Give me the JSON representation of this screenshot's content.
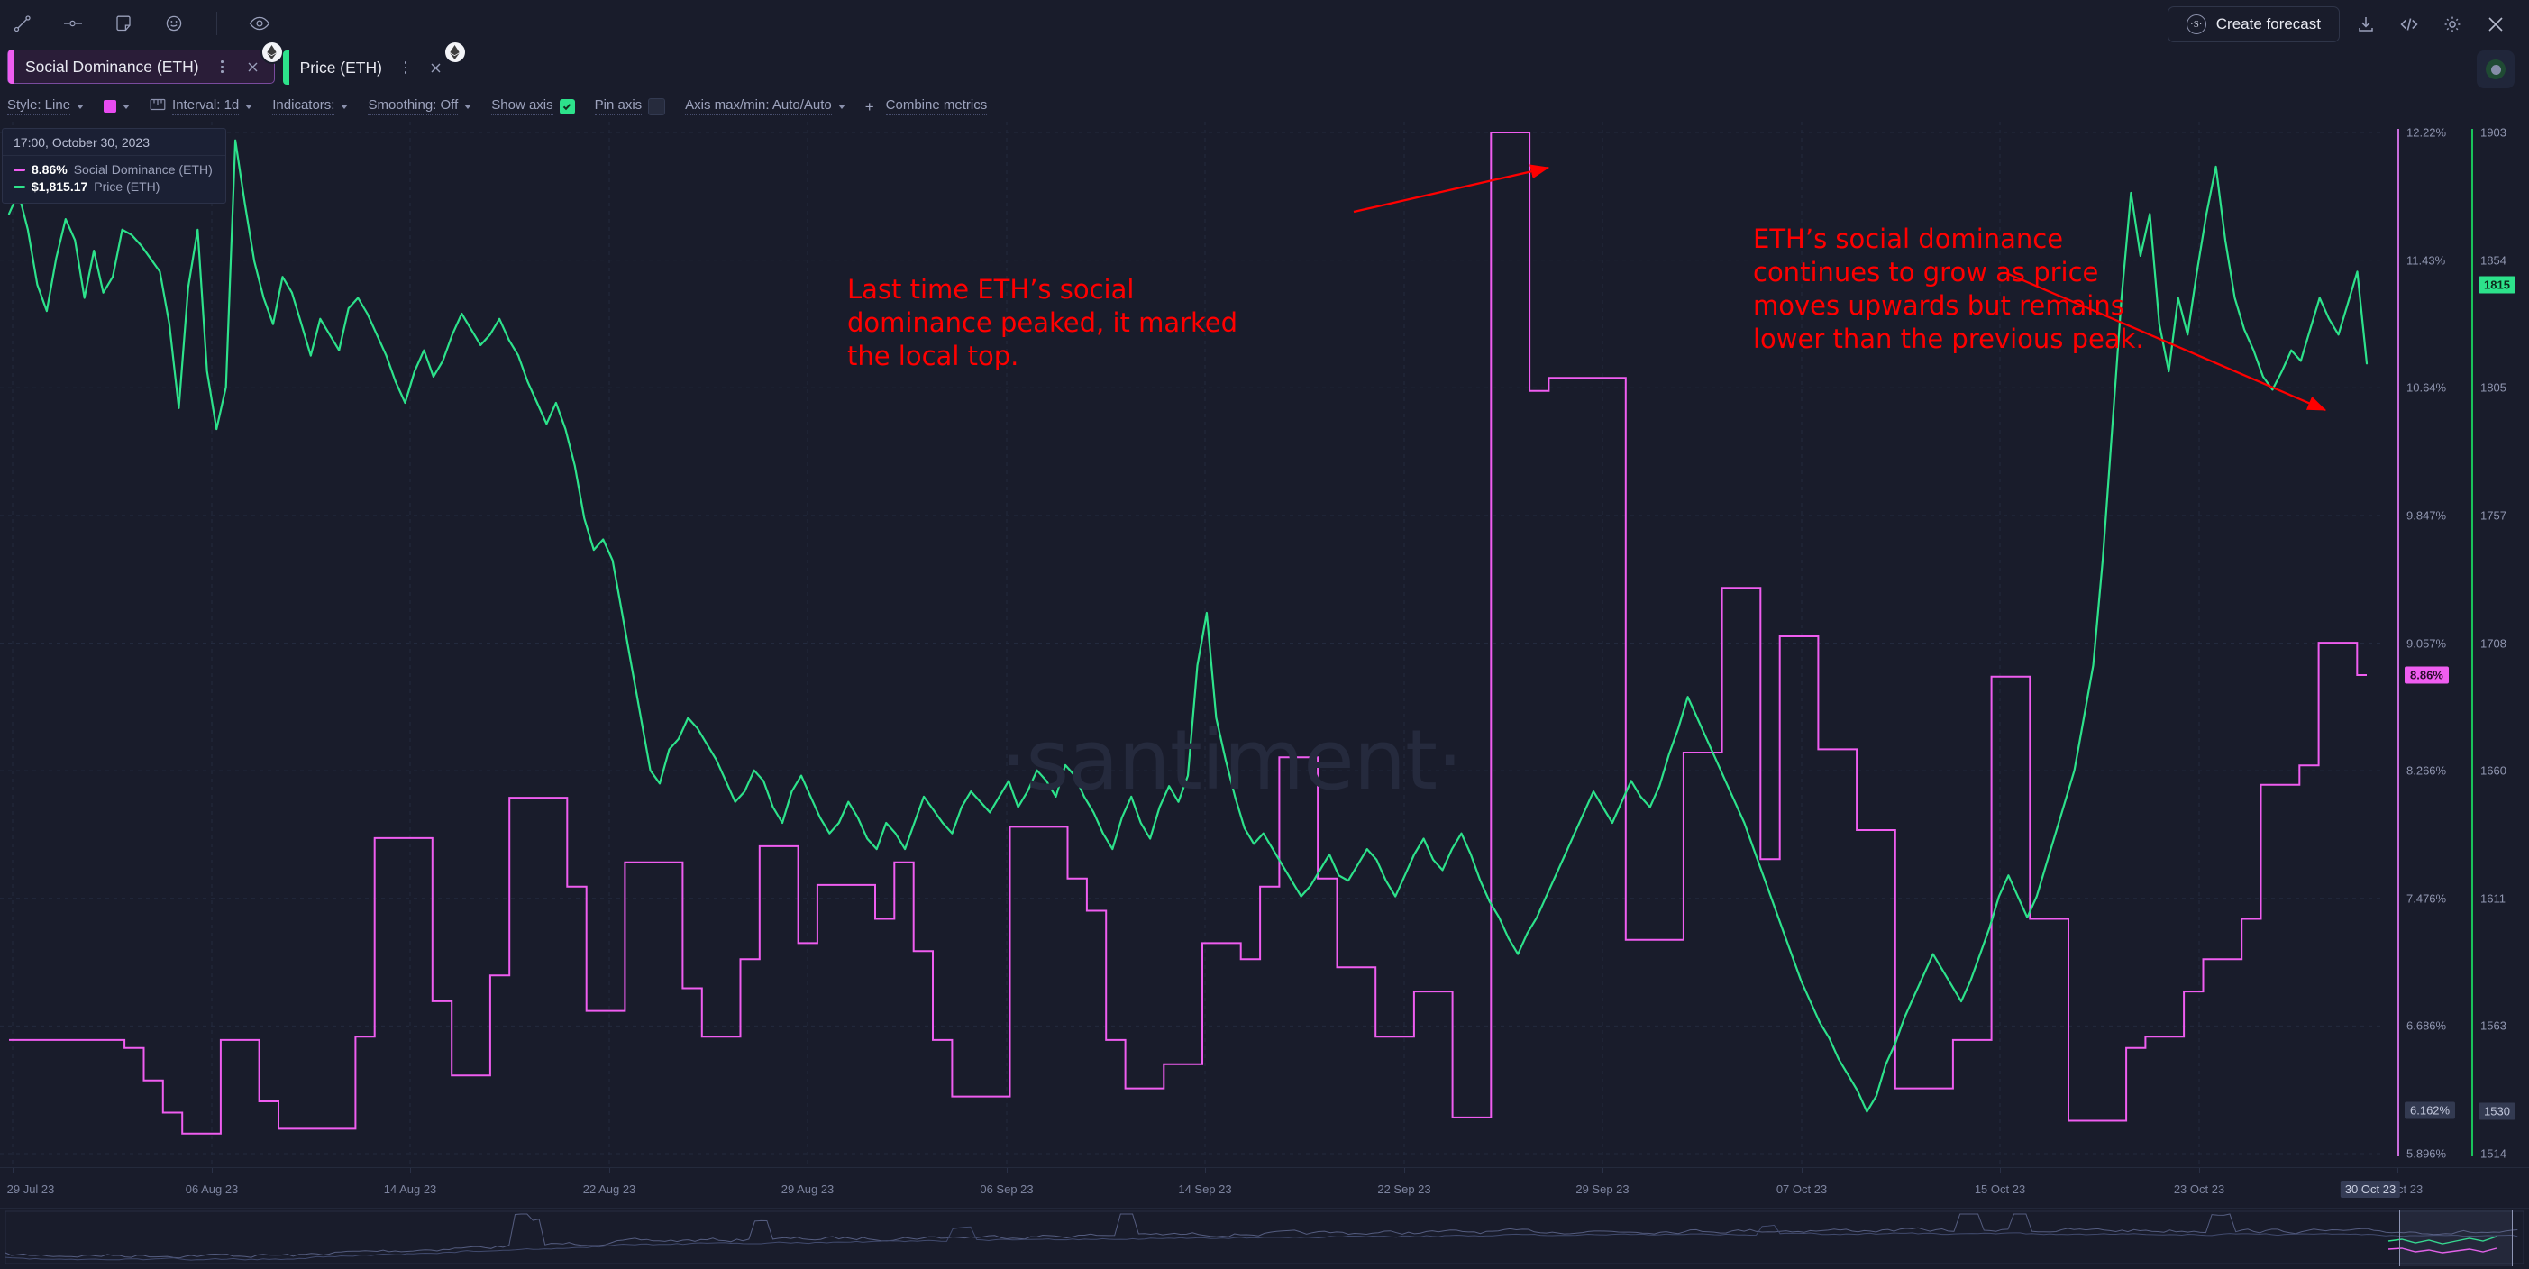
{
  "app": {
    "background": "#191c2b",
    "watermark": "·santiment·"
  },
  "toolbar": {
    "icons": [
      {
        "name": "trend-line-icon",
        "title": "Trend line"
      },
      {
        "name": "horizontal-line-icon",
        "title": "Horizontal line"
      },
      {
        "name": "note-icon",
        "title": "Note"
      },
      {
        "name": "emoji-icon",
        "title": "Emoji"
      },
      {
        "name": "visibility-icon",
        "title": "Show / hide"
      }
    ],
    "create_forecast_label": "Create forecast",
    "forecast_sigil": "·S·",
    "right_icons": [
      {
        "name": "download-icon"
      },
      {
        "name": "embed-code-icon"
      },
      {
        "name": "settings-gear-icon"
      },
      {
        "name": "close-icon"
      }
    ]
  },
  "metric_tabs": [
    {
      "label": "Social Dominance (ETH)",
      "color": "#ef5df0",
      "selected": true,
      "asset_badge": "ETH"
    },
    {
      "label": "Price (ETH)",
      "color": "#2de28b",
      "selected": false,
      "asset_badge": "ETH"
    }
  ],
  "settings_bar": {
    "style": "Style: Line",
    "color_swatch": "#e84bf0",
    "interval": "Interval: 1d",
    "indicators": "Indicators:",
    "smoothing": "Smoothing: Off",
    "show_axis": "Show axis",
    "show_axis_checked": true,
    "pin_axis": "Pin axis",
    "pin_axis_checked": false,
    "axis_max_min": "Axis max/min: Auto/Auto",
    "combine_metrics": "Combine metrics",
    "combine_plus": "+"
  },
  "legend": {
    "date": "17:00, October 30, 2023",
    "rows": [
      {
        "value": "8.86%",
        "name": "Social Dominance (ETH)",
        "color": "#ef5df0"
      },
      {
        "value": "$1,815.17",
        "name": "Price (ETH)",
        "color": "#2de28b"
      }
    ]
  },
  "annotations": [
    {
      "text": "Last time ETH’s social\ndominance peaked, it marked\nthe local top.",
      "color": "#ff0000"
    },
    {
      "text": "ETH’s social dominance\ncontinues to grow as price\nmoves upwards but remains\nlower than the previous peak.",
      "color": "#ff0000"
    }
  ],
  "axis_right": {
    "percent_ticks": [
      "12.22%",
      "11.43%",
      "10.64%",
      "9.847%",
      "9.057%",
      "8.266%",
      "7.476%",
      "6.686%",
      "5.896%"
    ],
    "price_ticks": [
      "1903",
      "1854",
      "1805",
      "1757",
      "1708",
      "1660",
      "1611",
      "1563",
      "1514"
    ],
    "current_price_badge": "1815",
    "current_percent_badge": "8.86%",
    "crosshair_percent_badge": "6.162%",
    "crosshair_price_badge": "1530",
    "percent_axis_color": "#c86ddc",
    "price_axis_color": "#19c25a"
  },
  "x_axis": {
    "ticks": [
      "29 Jul 23",
      "06 Aug 23",
      "14 Aug 23",
      "22 Aug 23",
      "29 Aug 23",
      "06 Sep 23",
      "14 Sep 23",
      "22 Sep 23",
      "29 Sep 23",
      "07 Oct 23",
      "15 Oct 23",
      "23 Oct 23",
      "31 Oct 23"
    ],
    "highlighted_tick": "30 Oct 23"
  },
  "chart_data": {
    "type": "line",
    "title": "Social Dominance (ETH) vs Price (ETH)",
    "xlabel": "",
    "ylabel": "",
    "grid": true,
    "legend_position": "top-left",
    "x_range": [
      "29 Jul 23",
      "31 Oct 23"
    ],
    "series": [
      {
        "name": "Social Dominance (ETH)",
        "color": "#ef5df0",
        "axis": "left-percent",
        "unit": "%",
        "ylim": [
          5.896,
          12.22
        ],
        "step": true,
        "values": [
          6.6,
          6.6,
          6.6,
          6.6,
          6.6,
          6.6,
          6.6,
          6.6,
          6.6,
          6.6,
          6.6,
          6.6,
          6.55,
          6.55,
          6.35,
          6.35,
          6.15,
          6.15,
          6.02,
          6.02,
          6.02,
          6.02,
          6.6,
          6.6,
          6.6,
          6.6,
          6.22,
          6.22,
          6.05,
          6.05,
          6.05,
          6.05,
          6.05,
          6.05,
          6.05,
          6.05,
          6.62,
          6.62,
          7.85,
          7.85,
          7.85,
          7.85,
          7.85,
          7.85,
          6.84,
          6.84,
          6.38,
          6.38,
          6.38,
          6.38,
          7.0,
          7.0,
          8.1,
          8.1,
          8.1,
          8.1,
          8.1,
          8.1,
          7.55,
          7.55,
          6.78,
          6.78,
          6.78,
          6.78,
          7.7,
          7.7,
          7.7,
          7.7,
          7.7,
          7.7,
          6.92,
          6.92,
          6.62,
          6.62,
          6.62,
          6.62,
          7.1,
          7.1,
          7.8,
          7.8,
          7.8,
          7.8,
          7.2,
          7.2,
          7.56,
          7.56,
          7.56,
          7.56,
          7.56,
          7.56,
          7.35,
          7.35,
          7.7,
          7.7,
          7.15,
          7.15,
          6.6,
          6.6,
          6.25,
          6.25,
          6.25,
          6.25,
          6.25,
          6.25,
          7.92,
          7.92,
          7.92,
          7.92,
          7.92,
          7.92,
          7.6,
          7.6,
          7.4,
          7.4,
          6.6,
          6.6,
          6.3,
          6.3,
          6.3,
          6.3,
          6.45,
          6.45,
          6.45,
          6.45,
          7.2,
          7.2,
          7.2,
          7.2,
          7.1,
          7.1,
          7.55,
          7.55,
          8.35,
          8.35,
          8.35,
          8.35,
          7.6,
          7.6,
          7.05,
          7.05,
          7.05,
          7.05,
          6.62,
          6.62,
          6.62,
          6.62,
          6.9,
          6.9,
          6.9,
          6.9,
          6.12,
          6.12,
          6.12,
          6.12,
          12.22,
          12.22,
          12.22,
          12.22,
          10.62,
          10.62,
          10.7,
          10.7,
          10.7,
          10.7,
          10.7,
          10.7,
          10.7,
          10.7,
          7.22,
          7.22,
          7.22,
          7.22,
          7.22,
          7.22,
          8.38,
          8.38,
          8.38,
          8.38,
          9.4,
          9.4,
          9.4,
          9.4,
          7.72,
          7.72,
          9.1,
          9.1,
          9.1,
          9.1,
          8.4,
          8.4,
          8.4,
          8.4,
          7.9,
          7.9,
          7.9,
          7.9,
          6.3,
          6.3,
          6.3,
          6.3,
          6.3,
          6.3,
          6.6,
          6.6,
          6.6,
          6.6,
          8.85,
          8.85,
          8.85,
          8.85,
          7.35,
          7.35,
          7.35,
          7.35,
          6.1,
          6.1,
          6.1,
          6.1,
          6.1,
          6.1,
          6.55,
          6.55,
          6.62,
          6.62,
          6.62,
          6.62,
          6.9,
          6.9,
          7.1,
          7.1,
          7.1,
          7.1,
          7.35,
          7.35,
          8.18,
          8.18,
          8.18,
          8.18,
          8.3,
          8.3,
          9.06,
          9.06,
          9.06,
          9.06,
          8.86,
          8.86
        ],
        "peak_value": 12.22,
        "last_value": 8.86
      },
      {
        "name": "Price (ETH)",
        "color": "#2de28b",
        "axis": "right-price",
        "unit": "USD",
        "ylim": [
          1514,
          1903
        ],
        "step": false,
        "values": [
          1872,
          1880,
          1866,
          1845,
          1835,
          1855,
          1870,
          1862,
          1840,
          1858,
          1842,
          1848,
          1866,
          1864,
          1860,
          1855,
          1850,
          1830,
          1798,
          1844,
          1866,
          1812,
          1790,
          1806,
          1900,
          1876,
          1854,
          1840,
          1830,
          1848,
          1842,
          1830,
          1818,
          1832,
          1826,
          1820,
          1836,
          1840,
          1834,
          1826,
          1818,
          1808,
          1800,
          1812,
          1820,
          1810,
          1816,
          1826,
          1834,
          1828,
          1822,
          1826,
          1832,
          1824,
          1818,
          1808,
          1800,
          1792,
          1800,
          1790,
          1776,
          1756,
          1744,
          1748,
          1740,
          1720,
          1700,
          1680,
          1660,
          1655,
          1668,
          1672,
          1680,
          1676,
          1670,
          1664,
          1656,
          1648,
          1652,
          1660,
          1656,
          1646,
          1640,
          1652,
          1658,
          1650,
          1642,
          1636,
          1640,
          1648,
          1642,
          1634,
          1630,
          1640,
          1636,
          1630,
          1640,
          1650,
          1645,
          1640,
          1636,
          1646,
          1652,
          1648,
          1644,
          1650,
          1656,
          1646,
          1652,
          1660,
          1656,
          1650,
          1662,
          1658,
          1650,
          1644,
          1636,
          1630,
          1642,
          1650,
          1640,
          1634,
          1646,
          1654,
          1648,
          1658,
          1700,
          1720,
          1680,
          1664,
          1650,
          1638,
          1632,
          1636,
          1630,
          1624,
          1618,
          1612,
          1616,
          1622,
          1628,
          1620,
          1618,
          1624,
          1630,
          1626,
          1618,
          1612,
          1620,
          1628,
          1634,
          1626,
          1622,
          1630,
          1636,
          1628,
          1618,
          1610,
          1604,
          1596,
          1590,
          1598,
          1604,
          1612,
          1620,
          1628,
          1636,
          1644,
          1652,
          1646,
          1640,
          1648,
          1656,
          1650,
          1646,
          1654,
          1666,
          1676,
          1688,
          1680,
          1672,
          1664,
          1656,
          1648,
          1640,
          1630,
          1620,
          1610,
          1600,
          1590,
          1580,
          1572,
          1564,
          1558,
          1550,
          1544,
          1538,
          1530,
          1536,
          1548,
          1556,
          1566,
          1574,
          1582,
          1590,
          1584,
          1578,
          1572,
          1580,
          1590,
          1600,
          1612,
          1620,
          1612,
          1604,
          1612,
          1624,
          1636,
          1648,
          1660,
          1680,
          1700,
          1740,
          1790,
          1840,
          1880,
          1856,
          1872,
          1830,
          1812,
          1840,
          1826,
          1850,
          1872,
          1890,
          1862,
          1840,
          1828,
          1820,
          1810,
          1805,
          1812,
          1820,
          1816,
          1828,
          1840,
          1832,
          1826,
          1838,
          1850,
          1815
        ],
        "last_value": 1815.17
      }
    ]
  },
  "navigator": {
    "name": "range-navigator",
    "window_label": ""
  }
}
